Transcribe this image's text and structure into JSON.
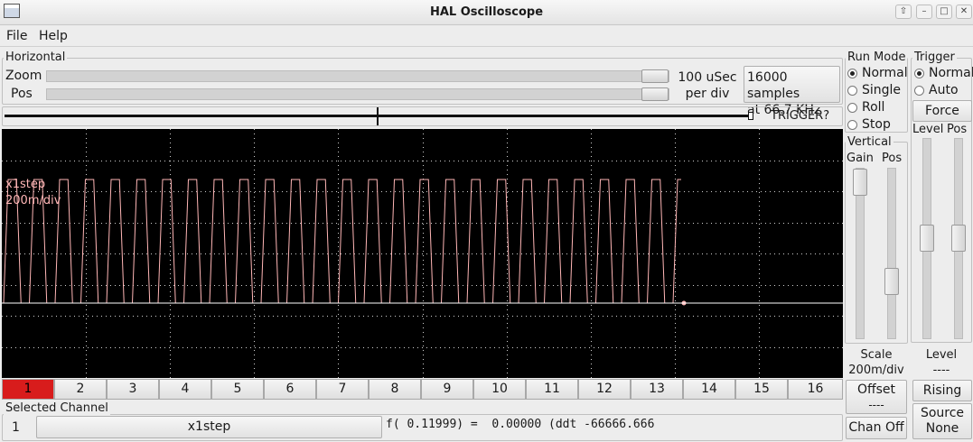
{
  "window": {
    "title": "HAL Oscilloscope"
  },
  "menu": {
    "file": "File",
    "help": "Help"
  },
  "horizontal": {
    "group_title": "Horizontal",
    "zoom_label": "Zoom",
    "pos_label": "Pos",
    "timebase_line1": "100 uSec",
    "timebase_line2": "per div",
    "samples_line1": "16000 samples",
    "samples_line2": "at 66.7 KHz",
    "trigger_status": "TRIGGER?"
  },
  "run_mode": {
    "title": "Run Mode",
    "options": [
      "Normal",
      "Single",
      "Roll",
      "Stop"
    ],
    "selected": "Normal"
  },
  "trigger": {
    "title": "Trigger",
    "options": [
      "Normal",
      "Auto"
    ],
    "selected": "Normal",
    "force_label": "Force",
    "level_label": "Level",
    "pos_label": "Pos",
    "level_title": "Level",
    "level_value": "----",
    "edge_label": "Rising",
    "source_title": "Source",
    "source_value": "None"
  },
  "vertical": {
    "title": "Vertical",
    "gain_label": "Gain",
    "pos_label": "Pos",
    "scale_title": "Scale",
    "scale_value": "200m/div",
    "offset_title": "Offset",
    "offset_value": "----",
    "chan_off_label": "Chan Off"
  },
  "scope": {
    "channel_name": "x1step",
    "channel_scale": "200m/div",
    "trace_color": "#ffb6b6",
    "grid_color": "#cfcfcf"
  },
  "channels": {
    "labels": [
      "1",
      "2",
      "3",
      "4",
      "5",
      "6",
      "7",
      "8",
      "9",
      "10",
      "11",
      "12",
      "13",
      "14",
      "15",
      "16"
    ],
    "selected_index": 0,
    "selected_color": "#d81c1c"
  },
  "selected_channel": {
    "title": "Selected Channel",
    "number": "1",
    "name": "x1step",
    "readout": "f( 0.11999) =  0.00000 (ddt -66666.666"
  }
}
